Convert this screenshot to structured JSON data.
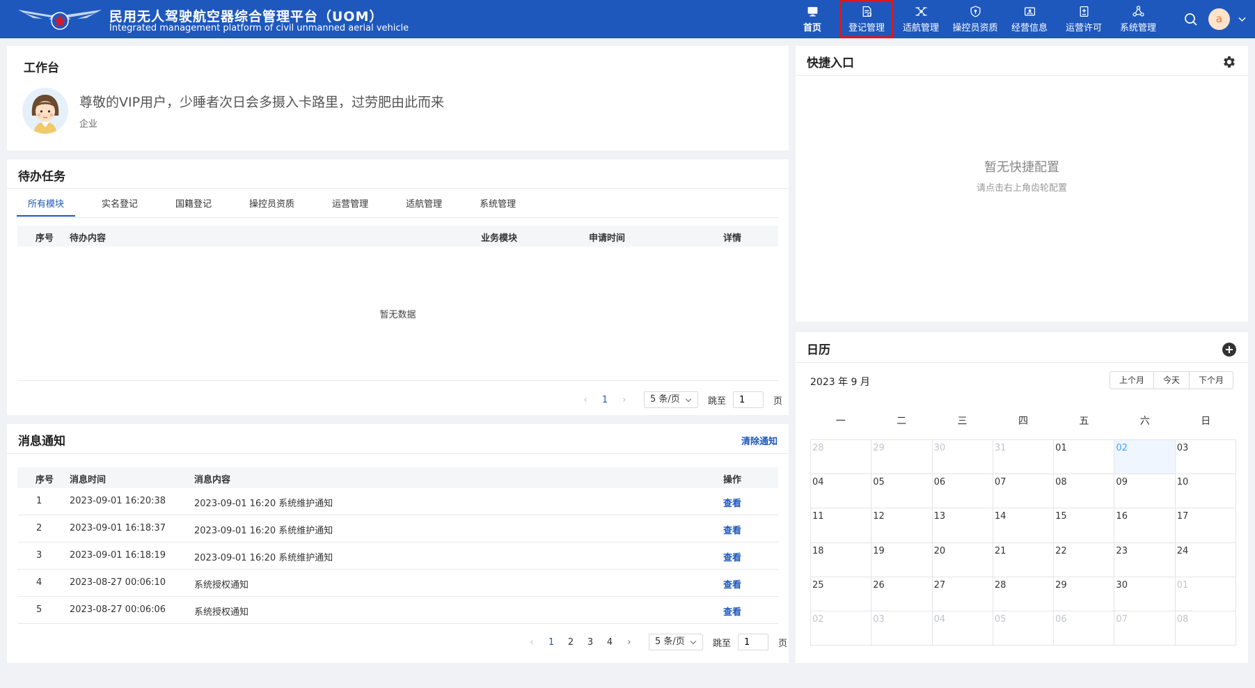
{
  "header": {
    "title": "民用无人驾驶航空器综合管理平台（UOM）",
    "subtitle": "Integrated management platform of civil unmanned aerial vehicle",
    "brand_color": "#1e58bd",
    "nav": [
      {
        "label": "首页",
        "icon": "monitor-icon"
      },
      {
        "label": "登记管理",
        "icon": "document-icon"
      },
      {
        "label": "适航管理",
        "icon": "drone-icon"
      },
      {
        "label": "操控员资质",
        "icon": "shield-icon"
      },
      {
        "label": "经营信息",
        "icon": "id-card-icon"
      },
      {
        "label": "运营许可",
        "icon": "permit-icon"
      },
      {
        "label": "系统管理",
        "icon": "cluster-icon"
      }
    ],
    "avatar_letter": "a"
  },
  "workbench": {
    "title": "工作台",
    "greeting": "尊敬的VIP用户，少睡者次日会多摄入卡路里，过劳肥由此而来",
    "role": "企业"
  },
  "todo": {
    "title": "待办任务",
    "tabs": [
      "所有模块",
      "实名登记",
      "国籍登记",
      "操控员资质",
      "运营管理",
      "适航管理",
      "系统管理"
    ],
    "columns": [
      "序号",
      "待办内容",
      "业务模块",
      "申请时间",
      "详情"
    ],
    "empty_text": "暂无数据",
    "pager": {
      "pages": [
        "1"
      ],
      "size": "5 条/页",
      "jump_label": "跳至",
      "jump_value": "1",
      "page_label": "页"
    }
  },
  "messages": {
    "title": "消息通知",
    "clear": "清除通知",
    "columns": [
      "序号",
      "消息时间",
      "消息内容",
      "操作"
    ],
    "rows": [
      {
        "no": "1",
        "time": "2023-09-01 16:20:38",
        "content": "2023-09-01 16:20 系统维护通知",
        "action": "查看"
      },
      {
        "no": "2",
        "time": "2023-09-01 16:18:37",
        "content": "2023-09-01 16:20 系统维护通知",
        "action": "查看"
      },
      {
        "no": "3",
        "time": "2023-09-01 16:18:19",
        "content": "2023-09-01 16:20 系统维护通知",
        "action": "查看"
      },
      {
        "no": "4",
        "time": "2023-08-27 00:06:10",
        "content": "系统授权通知",
        "action": "查看"
      },
      {
        "no": "5",
        "time": "2023-08-27 00:06:06",
        "content": "系统授权通知",
        "action": "查看"
      }
    ],
    "pager": {
      "pages": [
        "1",
        "2",
        "3",
        "4"
      ],
      "size": "5 条/页",
      "jump_label": "跳至",
      "jump_value": "1",
      "page_label": "页"
    }
  },
  "quick": {
    "title": "快捷入口",
    "empty": "暂无快捷配置",
    "hint": "请点击右上角齿轮配置"
  },
  "calendar": {
    "title": "日历",
    "month": "2023 年 9 月",
    "buttons": [
      "上个月",
      "今天",
      "下个月"
    ],
    "weekdays": [
      "一",
      "二",
      "三",
      "四",
      "五",
      "六",
      "日"
    ],
    "days": [
      "28",
      "29",
      "30",
      "31",
      "01",
      "02",
      "03",
      "04",
      "05",
      "06",
      "07",
      "08",
      "09",
      "10",
      "11",
      "12",
      "13",
      "14",
      "15",
      "16",
      "17",
      "18",
      "19",
      "20",
      "21",
      "22",
      "23",
      "24",
      "25",
      "26",
      "27",
      "28",
      "29",
      "30",
      "01",
      "02",
      "03",
      "04",
      "05",
      "06",
      "07",
      "08"
    ],
    "other_month_indices": [
      0,
      1,
      2,
      3,
      34,
      35,
      36,
      37,
      38,
      39,
      40,
      41
    ],
    "today_index": 5
  }
}
